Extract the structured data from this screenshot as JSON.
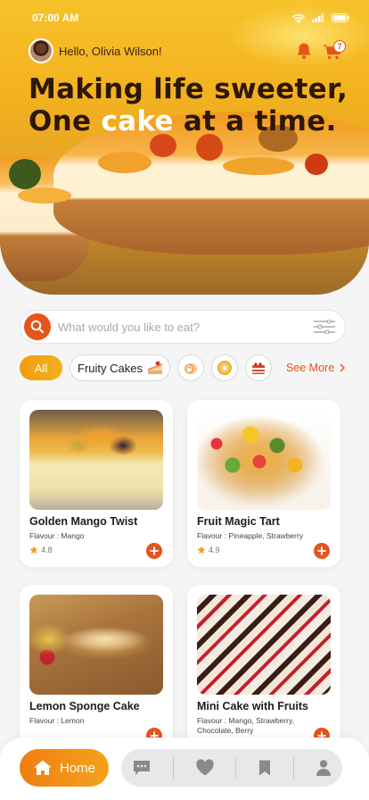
{
  "status_bar": {
    "time": "07:00 AM"
  },
  "header": {
    "greeting": "Hello, Olivia Wilson!",
    "cart_count": "7",
    "headline_line1": "Making life sweeter,",
    "headline_line2_before": "One ",
    "headline_line2_highlight": "cake",
    "headline_line2_after": " at a time."
  },
  "search": {
    "placeholder": "What would you like to eat?"
  },
  "categories": {
    "all_label": "All",
    "fruity_label": "Fruity Cakes",
    "see_more_label": "See More"
  },
  "products": [
    {
      "name": "Golden Mango Twist",
      "flavour": "Flavour : Mango",
      "rating": "4.8"
    },
    {
      "name": "Fruit Magic Tart",
      "flavour": "Flavour : Pineapple, Strawberry",
      "rating": "4.9"
    },
    {
      "name": "Lemon Sponge Cake",
      "flavour": "Flavour : Lemon",
      "rating": ""
    },
    {
      "name": "Mini Cake with Fruits",
      "flavour": "Flavour : Mango, Strawberry, Chocolate, Berry",
      "rating": ""
    }
  ],
  "nav": {
    "home_label": "Home"
  },
  "colors": {
    "accent": "#e8531a",
    "gradient_start": "#f07e12",
    "gradient_end": "#f4a21c"
  }
}
